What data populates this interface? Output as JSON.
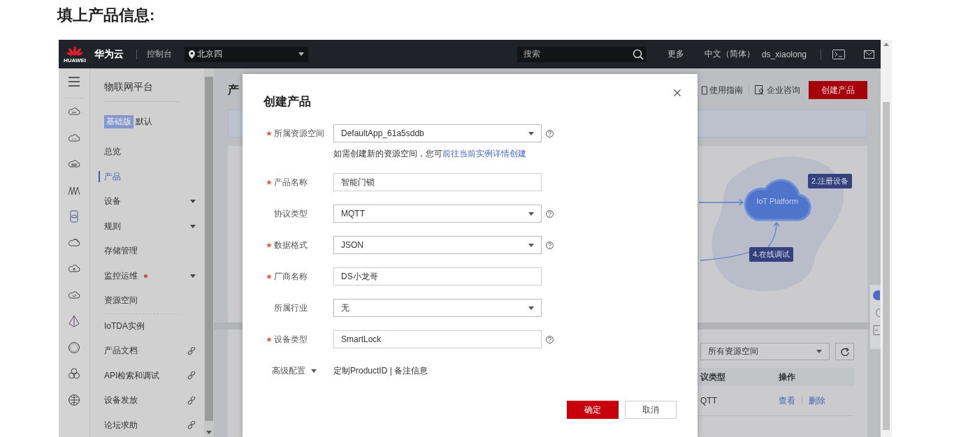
{
  "heading": "填上产品信息:",
  "top_bar": {
    "logo_text": "HUAWEI",
    "brand": "华为云",
    "console": "控制台",
    "region": "北京四",
    "search_placeholder": "搜索",
    "links": [
      "更多",
      "中文（简体）",
      "ds_xiaolong"
    ]
  },
  "sidebar": {
    "title": "物联网平台",
    "edition_badge": "基础版",
    "edition": "默认",
    "items": [
      {
        "label": "总览",
        "kind": "plain",
        "selected": false,
        "alert": false,
        "divider_above": false
      },
      {
        "label": "产品",
        "kind": "plain",
        "selected": true,
        "alert": false,
        "divider_above": false
      },
      {
        "label": "设备",
        "kind": "dropdown",
        "selected": false,
        "alert": false,
        "divider_above": false
      },
      {
        "label": "规则",
        "kind": "dropdown",
        "selected": false,
        "alert": false,
        "divider_above": false
      },
      {
        "label": "存储管理",
        "kind": "plain",
        "selected": false,
        "alert": false,
        "divider_above": false
      },
      {
        "label": "监控运维",
        "kind": "dropdown",
        "selected": false,
        "alert": true,
        "divider_above": false
      },
      {
        "label": "资源空间",
        "kind": "plain",
        "selected": false,
        "alert": false,
        "divider_above": false
      },
      {
        "label": "IoTDA实例",
        "kind": "plain",
        "selected": false,
        "alert": false,
        "divider_above": true
      },
      {
        "label": "产品文档",
        "kind": "link",
        "selected": false,
        "alert": false,
        "divider_above": false
      },
      {
        "label": "API检索和调试",
        "kind": "link",
        "selected": false,
        "alert": false,
        "divider_above": false
      },
      {
        "label": "设备发放",
        "kind": "link",
        "selected": false,
        "alert": false,
        "divider_above": false
      },
      {
        "label": "论坛求助",
        "kind": "link",
        "selected": false,
        "alert": false,
        "divider_above": false
      }
    ]
  },
  "page": {
    "title": "产",
    "actions": [
      "使用指南",
      "企业咨询"
    ],
    "create_button": "创建产品",
    "diagram": {
      "center": "IoT Platform",
      "steps": [
        "2.注册设备",
        "4.在线调试"
      ]
    },
    "filter": {
      "value": "所有资源空间"
    },
    "table": {
      "columns": [
        "议类型",
        "操作"
      ],
      "rows": [
        {
          "protocol": "QTT",
          "actions": [
            "查看",
            "删除"
          ]
        }
      ]
    }
  },
  "dialog": {
    "title": "创建产品",
    "fields": [
      {
        "label": "所属资源空间",
        "value": "DefaultApp_61a5sddb",
        "kind": "select",
        "required": true,
        "help": true,
        "hint": {
          "text": "如需创建新的资源空间，您可",
          "link": "前往当前实例详情创建"
        }
      },
      {
        "label": "产品名称",
        "value": "智能门锁",
        "kind": "input",
        "required": true,
        "help": false
      },
      {
        "label": "协议类型",
        "value": "MQTT",
        "kind": "select",
        "required": false,
        "help": true
      },
      {
        "label": "数据格式",
        "value": "JSON",
        "kind": "select",
        "required": true,
        "help": true
      },
      {
        "label": "厂商名称",
        "value": "DS小龙哥",
        "kind": "input",
        "required": true,
        "help": false
      },
      {
        "label": "所属行业",
        "value": "无",
        "kind": "select",
        "required": false,
        "help": false
      },
      {
        "label": "设备类型",
        "value": "SmartLock",
        "kind": "input",
        "required": true,
        "help": true
      }
    ],
    "advanced": {
      "label": "高级配置",
      "options": "定制ProductID | 备注信息"
    },
    "buttons": [
      {
        "label": "确定",
        "kind": "primary"
      },
      {
        "label": "取消",
        "kind": "secondary"
      }
    ]
  }
}
